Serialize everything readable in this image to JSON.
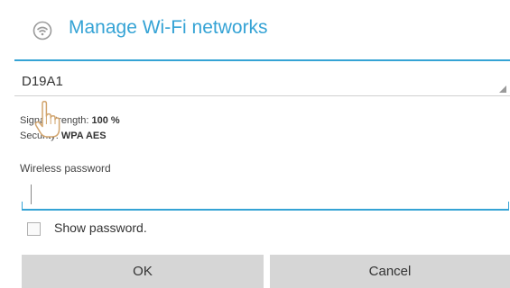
{
  "dialog": {
    "title": "Manage Wi-Fi networks",
    "title_icon": "wifi-settings-icon",
    "accent_color": "#35a3d5"
  },
  "network": {
    "selected": "D19A1",
    "signal_label": "Signal strength:",
    "signal_value": "100 %",
    "security_label": "Security:",
    "security_value": "WPA AES"
  },
  "password": {
    "label": "Wireless password",
    "value": "",
    "show_label": "Show password.",
    "show_checked": false
  },
  "buttons": {
    "ok": "OK",
    "cancel": "Cancel"
  },
  "cursor": {
    "icon": "hand-pointer-icon"
  }
}
